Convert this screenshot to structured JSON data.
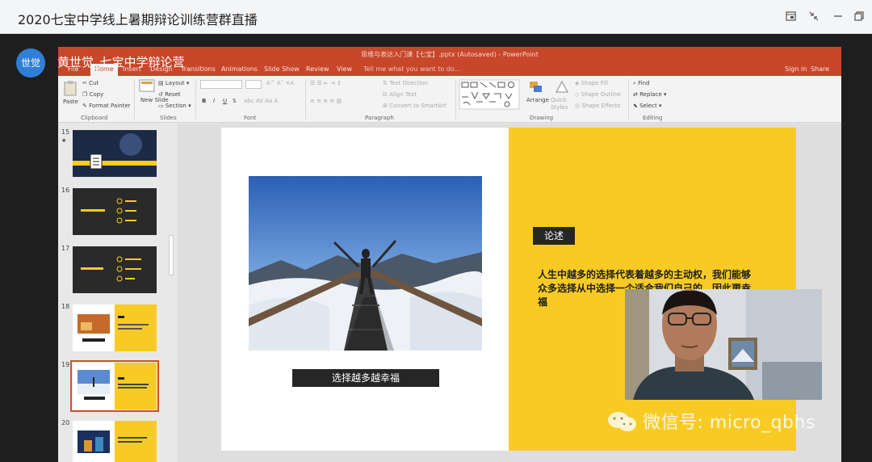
{
  "app": {
    "title": "2020七宝中学线上暑期辩论训练营群直播",
    "window_buttons": [
      "popout-icon",
      "collapse-icon",
      "minimize-icon",
      "restore-icon"
    ]
  },
  "presenter": {
    "avatar_text": "世觉",
    "name": "黄世觉_七宝中学辩论营"
  },
  "powerpoint": {
    "filename": "思维与表达入门课【七宝】.pptx (Autosaved) - PowerPoint",
    "tabs": [
      "File",
      "Home",
      "Insert",
      "Design",
      "Transitions",
      "Animations",
      "Slide Show",
      "Review",
      "View"
    ],
    "active_tab": "Home",
    "tell_me": "Tell me what you want to do...",
    "sign_in": "Sign in",
    "share": "Share",
    "ribbon": {
      "clipboard": {
        "paste": "Paste",
        "cut": "Cut",
        "copy": "Copy",
        "format_painter": "Format Painter",
        "group": "Clipboard"
      },
      "slides": {
        "new_slide": "New Slide",
        "layout": "Layout",
        "reset": "Reset",
        "section": "Section",
        "group": "Slides"
      },
      "font": {
        "group": "Font",
        "buttons": [
          "B",
          "I",
          "U",
          "S"
        ]
      },
      "paragraph": {
        "text_direction": "Text Direction",
        "align_text": "Align Text",
        "convert": "Convert to SmartArt",
        "group": "Paragraph"
      },
      "drawing": {
        "arrange": "Arrange",
        "quick_styles": "Quick Styles",
        "shape_fill": "Shape Fill",
        "shape_outline": "Shape Outline",
        "shape_effects": "Shape Effects",
        "group": "Drawing"
      },
      "editing": {
        "find": "Find",
        "replace": "Replace",
        "select": "Select",
        "group": "Editing"
      }
    },
    "thumbnails": [
      {
        "num": "15",
        "star": "★",
        "selected": false
      },
      {
        "num": "16",
        "star": "",
        "selected": false
      },
      {
        "num": "17",
        "star": "",
        "selected": false
      },
      {
        "num": "18",
        "star": "",
        "selected": false
      },
      {
        "num": "19",
        "star": "",
        "selected": true
      },
      {
        "num": "20",
        "star": "",
        "selected": false
      }
    ],
    "slide": {
      "caption": "选择越多越幸福",
      "label": "论述",
      "body": "人生中越多的选择代表着越多的主动权，我们能够众多选择从中选择一个适合我们自己的，因此更幸福"
    }
  },
  "watermark": {
    "text": "微信号: micro_qbhs"
  },
  "colors": {
    "ppt_red": "#c8462a",
    "slide_yellow": "#f8cb24",
    "avatar_blue": "#2f7fd6"
  }
}
